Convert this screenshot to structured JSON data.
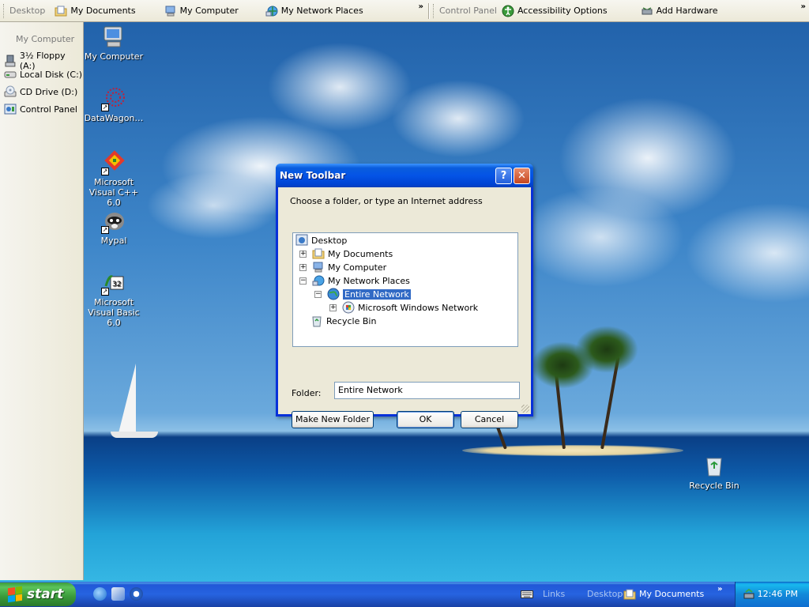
{
  "top_toolbar": {
    "desktop_title": "Desktop",
    "desktop_items": [
      {
        "label": "My Documents",
        "icon": "my-documents-icon"
      },
      {
        "label": "My Computer",
        "icon": "my-computer-icon"
      },
      {
        "label": "My Network Places",
        "icon": "network-places-icon"
      }
    ],
    "control_panel_title": "Control Panel",
    "control_panel_items": [
      {
        "label": "Accessibility Options",
        "icon": "accessibility-icon"
      },
      {
        "label": "Add Hardware",
        "icon": "add-hardware-icon"
      }
    ],
    "chevron": "»"
  },
  "side_toolbar": {
    "title": "My Computer",
    "items": [
      {
        "label": "3½ Floppy (A:)",
        "icon": "floppy-icon"
      },
      {
        "label": "Local Disk (C:)",
        "icon": "hard-disk-icon"
      },
      {
        "label": "CD Drive (D:)",
        "icon": "cd-drive-icon"
      },
      {
        "label": "Control Panel",
        "icon": "control-panel-icon"
      }
    ]
  },
  "desktop_icons": [
    {
      "label": "My Computer",
      "icon": "my-computer-icon"
    },
    {
      "label": "DataWagon…",
      "icon": "datawagon-icon"
    },
    {
      "label": "Microsoft Visual C++ 6.0",
      "icon": "visual-cpp-icon"
    },
    {
      "label": "Mypal",
      "icon": "mypal-icon"
    },
    {
      "label": "Microsoft Visual Basic 6.0",
      "icon": "visual-basic-icon"
    },
    {
      "label": "Recycle Bin",
      "icon": "recycle-bin-icon"
    }
  ],
  "dialog": {
    "title": "New Toolbar",
    "help_glyph": "?",
    "close_glyph": "✕",
    "prompt": "Choose a folder, or type an Internet address",
    "tree": [
      {
        "label": "Desktop",
        "icon": "desktop-icon",
        "expander": ""
      },
      {
        "label": "My Documents",
        "icon": "my-documents-icon",
        "expander": "+"
      },
      {
        "label": "My Computer",
        "icon": "my-computer-icon",
        "expander": "+"
      },
      {
        "label": "My Network Places",
        "icon": "network-places-icon",
        "expander": "−"
      },
      {
        "label": "Entire Network",
        "icon": "globe-icon",
        "expander": "−",
        "selected": true
      },
      {
        "label": "Microsoft Windows Network",
        "icon": "windows-network-icon",
        "expander": "+"
      },
      {
        "label": "Recycle Bin",
        "icon": "recycle-bin-icon",
        "expander": ""
      }
    ],
    "folder_label": "Folder:",
    "folder_value": "Entire Network",
    "make_new_folder": "Make New Folder",
    "ok": "OK",
    "cancel": "Cancel"
  },
  "taskbar": {
    "start_label": "start",
    "quick_launch": [
      "internet-explorer-icon",
      "media-icon",
      "media-player-icon"
    ],
    "links_label": "Links",
    "desktop_label": "Desktop",
    "my_documents_label": "My Documents",
    "chevron": "»",
    "clock": "12:46 PM"
  },
  "colors": {
    "xp_blue": "#0831d9",
    "selection": "#316ac5",
    "dialog_face": "#ece9d8",
    "start_green": "#3a9a3a"
  }
}
